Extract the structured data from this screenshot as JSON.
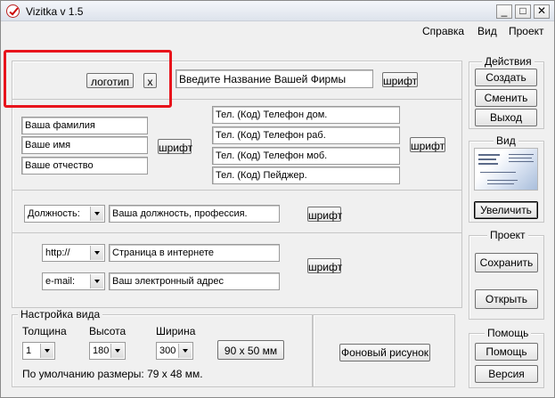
{
  "window": {
    "title": "Vizitka v 1.5",
    "controls": {
      "minimize": "_",
      "maximize": "□",
      "close": "✕"
    }
  },
  "menu": [
    "Справка",
    "Вид",
    "Проект"
  ],
  "logo": {
    "button": "логотип",
    "remove": "x"
  },
  "company": {
    "placeholder": "Введите Название Вашей Фирмы",
    "font_button": "шрифт"
  },
  "person": {
    "surname": "Ваша фамилия",
    "name": "Ваше имя",
    "patronymic": "Ваше отчество",
    "font_button": "шрифт"
  },
  "phones": {
    "home": "Тел. (Код) Телефон дом.",
    "work": "Тел. (Код) Телефон раб.",
    "mobile": "Тел. (Код) Телефон моб.",
    "pager": "Тел. (Код) Пейджер.",
    "font_button": "шрифт"
  },
  "position": {
    "combo": "Должность:",
    "value": "Ваша должность, профессия.",
    "font_button": "шрифт"
  },
  "internet": {
    "web_combo": "http://",
    "web_value": "Страница в интернете",
    "mail_combo": "e-mail:",
    "mail_value": "Ваш электронный адрес",
    "font_button": "шрифт"
  },
  "view_settings": {
    "title": "Настройка вида",
    "thickness_label": "Толщина",
    "thickness_value": "1",
    "height_label": "Высота",
    "height_value": "180",
    "width_label": "Ширина",
    "width_value": "300",
    "size_button": "90 x 50 мм",
    "default_note": "По умолчанию размеры: 79 x 48 мм.",
    "background_button": "Фоновый рисунок"
  },
  "actions": {
    "title": "Действия",
    "create": "Создать",
    "change": "Сменить",
    "exit": "Выход"
  },
  "view": {
    "title": "Вид",
    "enlarge": "Увеличить"
  },
  "project": {
    "title": "Проект",
    "save": "Сохранить",
    "open": "Открыть"
  },
  "help": {
    "title": "Помощь",
    "help": "Помощь",
    "version": "Версия"
  },
  "colors": {
    "highlight_frame": "#e8131b",
    "window_bg": "#f0f0f0"
  }
}
